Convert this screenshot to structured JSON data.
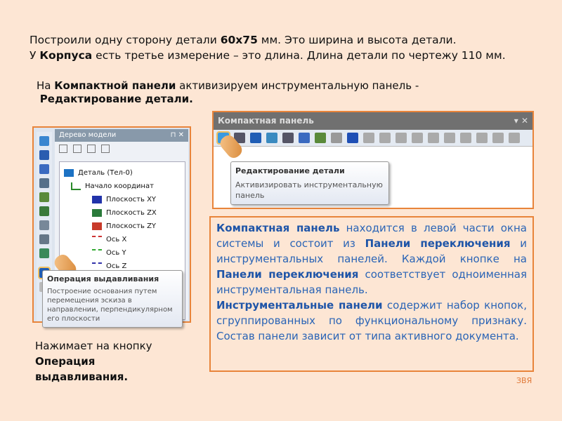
{
  "intro": {
    "p1": "Построили одну сторону детали ",
    "p1b": "60х75",
    "p1c": " мм. Это ширина и высота детали.",
    "p2": "У ",
    "p2b": "Корпуса",
    "p2c": " есть третье измерение – это длина. Длина детали по чертежу 110 мм."
  },
  "sub": {
    "a": "На ",
    "b": "Компактной панели",
    "c": " активизируем инструментальную панель -",
    "d": "Редактирование детали."
  },
  "tree": {
    "title": "Дерево модели",
    "pin": "⊓",
    "close": "✕",
    "nodes": [
      "Деталь (Тел-0)",
      "Начало координат",
      "Плоскость XY",
      "Плоскость ZX",
      "Плоскость ZY",
      "Ось X",
      "Ось Y",
      "Ось Z"
    ],
    "tooltip": {
      "title": "Операция выдавливания",
      "text": "Построение основания путем перемещения эскиза в направлении, перпендикулярном его плоскости"
    }
  },
  "compact": {
    "title": "Компактная панель",
    "menu": "▾",
    "close": "✕",
    "tooltip": {
      "title": "Редактирование детали",
      "text": "Активизировать инструментальную панель"
    }
  },
  "desc": {
    "b1": "Компактная панель",
    "t1": " находится в левой части окна системы и состоит из ",
    "b2": "Панели переключения",
    "t2": " и инструментальных панелей. Каждой кнопке на ",
    "b3": "Панели переключения",
    "t3": " соответствует одноименная инструментальная панель.",
    "b4": "Инструментальные панели",
    "t4": " содержит набор кнопок, сгруппированных по функциональному признаку. Состав панели зависит от типа активного документа."
  },
  "bottom": {
    "a": "Нажимает на кнопку",
    "b": "Операция",
    "c": "выдавливания."
  },
  "mark": "ЗВЯ"
}
